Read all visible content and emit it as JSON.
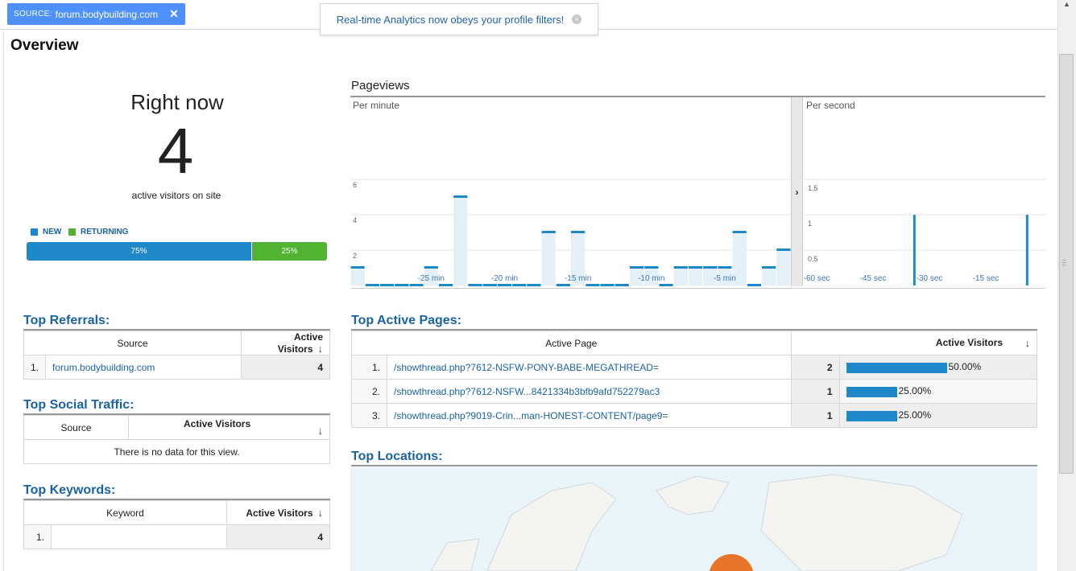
{
  "filter_chip": {
    "key": "SOURCE:",
    "value": "forum.bodybuilding.com",
    "close": "✕"
  },
  "notice": {
    "text": "Real-time Analytics now obeys your profile filters!",
    "close": "×"
  },
  "page_title": "Overview",
  "right_now": {
    "label": "Right now",
    "count": "4",
    "subtitle": "active visitors on site",
    "legend_new": "NEW",
    "legend_returning": "RETURNING",
    "new_pct": "75%",
    "returning_pct": "25%",
    "new_fraction": 0.75,
    "colors": {
      "new": "#1e88c8",
      "returning": "#50b432"
    }
  },
  "chart_data": [
    {
      "type": "bar",
      "title": "Pageviews",
      "subtitle": "Per minute",
      "ylim": [
        0,
        8
      ],
      "yticks": [
        "2",
        "4",
        "6"
      ],
      "xticks": [
        {
          "minute": -25,
          "label": "-25 min"
        },
        {
          "minute": -20,
          "label": "-20 min"
        },
        {
          "minute": -15,
          "label": "-15 min"
        },
        {
          "minute": -10,
          "label": "-10 min"
        },
        {
          "minute": -5,
          "label": "-5 min"
        }
      ],
      "minutes": [
        -30,
        -29,
        -28,
        -27,
        -26,
        -25,
        -24,
        -23,
        -22,
        -21,
        -20,
        -19,
        -18,
        -17,
        -16,
        -15,
        -14,
        -13,
        -12,
        -11,
        -10,
        -9,
        -8,
        -7,
        -6,
        -5,
        -4,
        -3,
        -2,
        -1
      ],
      "values": [
        1,
        0,
        0,
        0,
        0,
        1,
        0,
        5,
        0,
        0,
        0,
        0,
        0,
        3,
        0,
        3,
        0,
        0,
        0,
        1,
        1,
        0,
        1,
        1,
        1,
        1,
        3,
        0,
        1,
        2
      ]
    },
    {
      "type": "bar",
      "subtitle": "Per second",
      "ylim": [
        0,
        2
      ],
      "yticks": [
        "0.5",
        "1",
        "1.5"
      ],
      "xticks": [
        {
          "second": -60,
          "label": "-60 sec"
        },
        {
          "second": -45,
          "label": "-45 sec"
        },
        {
          "second": -30,
          "label": "-30 sec"
        },
        {
          "second": -15,
          "label": "-15 sec"
        }
      ],
      "seconds": [
        -34,
        -4
      ],
      "values": [
        1,
        1
      ]
    }
  ],
  "top_referrals": {
    "title": "Top Referrals:",
    "columns": [
      "Source",
      "Active Visitors"
    ],
    "rows": [
      {
        "idx": "1.",
        "source": "forum.bodybuilding.com",
        "visitors": "4"
      }
    ]
  },
  "top_social": {
    "title": "Top Social Traffic:",
    "columns": [
      "Source",
      "Active Visitors"
    ],
    "empty": "There is no data for this view."
  },
  "top_keywords": {
    "title": "Top Keywords:",
    "columns": [
      "Keyword",
      "Active Visitors"
    ],
    "rows": [
      {
        "idx": "1.",
        "keyword": "",
        "visitors": "4"
      }
    ]
  },
  "top_pages": {
    "title": "Top Active Pages:",
    "columns": [
      "Active Page",
      "Active Visitors"
    ],
    "rows": [
      {
        "idx": "1.",
        "page": "/showthread.php?7612-NSFW-PONY-BABE-MEGATHREAD=",
        "visitors": "2",
        "pct": "50.00%",
        "fraction": 0.5
      },
      {
        "idx": "2.",
        "page": "/showthread.php?7612-NSFW...8421334b3bfb9afd752279ac3",
        "visitors": "1",
        "pct": "25.00%",
        "fraction": 0.25
      },
      {
        "idx": "3.",
        "page": "/showthread.php?9019-Crin...man-HONEST-CONTENT/page9=",
        "visitors": "1",
        "pct": "25.00%",
        "fraction": 0.25
      }
    ]
  },
  "top_locations": {
    "title": "Top Locations:"
  },
  "icons": {
    "sort": "sort-descending-arrow-icon",
    "expand": "chevron-right-icon"
  }
}
